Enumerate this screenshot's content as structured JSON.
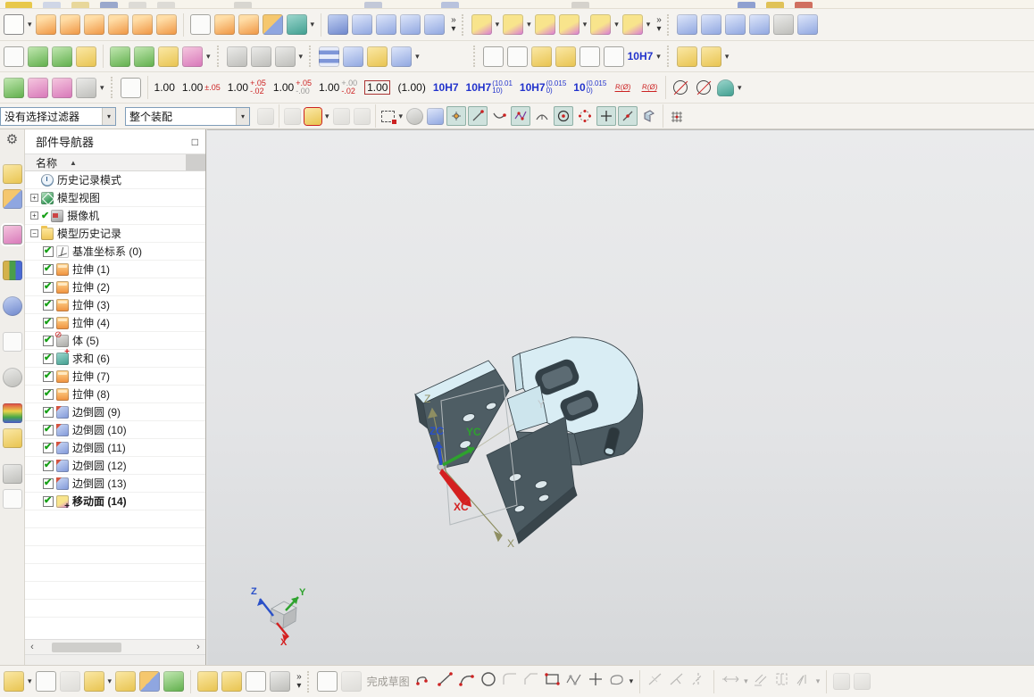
{
  "glyphs": {
    "caret": "▾",
    "more": "»",
    "sort": "▲",
    "box": "□",
    "left": "‹",
    "right": "›",
    "check": "✔",
    "gear": "⚙"
  },
  "toolbars": {
    "dim": {
      "items": [
        {
          "main": "1.00"
        },
        {
          "main": "1.00",
          "t": "±.05"
        },
        {
          "main": "1.00",
          "t": "+.05",
          "b": "-.02"
        },
        {
          "main": "1.00",
          "t": "+.05",
          "b": "-.00"
        },
        {
          "main": "1.00",
          "t": "+.00",
          "b": "-.02"
        },
        {
          "main": "1.00"
        },
        {
          "main": "(1.00)"
        },
        {
          "main": "10H7"
        },
        {
          "main": "10H7",
          "s1": "(10.01",
          "s2": "10)"
        },
        {
          "main": "10H7",
          "s1": "(0.015",
          "s2": "0)"
        },
        {
          "main": "10",
          "s1": "(0.015",
          "s2": "0)"
        }
      ],
      "radius_label": "R(Ø)"
    },
    "row3": {
      "fit_label": "10H7"
    }
  },
  "selection_bar": {
    "filter_value": "没有选择过滤器",
    "scope_value": "整个装配"
  },
  "navigator": {
    "title": "部件导航器",
    "column": "名称",
    "items": [
      {
        "label": "历史记录模式",
        "icon": "history-mode",
        "exp": ""
      },
      {
        "label": "模型视图",
        "icon": "model-views",
        "exp": "+"
      },
      {
        "label": "摄像机",
        "icon": "camera",
        "exp": "+",
        "pre": "✔"
      },
      {
        "label": "模型历史记录",
        "icon": "history-folder",
        "exp": "−"
      },
      {
        "label": "基准坐标系 (0)",
        "icon": "datum-csys",
        "checked": true
      },
      {
        "label": "拉伸 (1)",
        "icon": "extrude",
        "checked": true
      },
      {
        "label": "拉伸 (2)",
        "icon": "extrude",
        "checked": true
      },
      {
        "label": "拉伸 (3)",
        "icon": "extrude",
        "checked": true
      },
      {
        "label": "拉伸 (4)",
        "icon": "extrude",
        "checked": true
      },
      {
        "label": "体 (5)",
        "icon": "body",
        "checked": true
      },
      {
        "label": "求和 (6)",
        "icon": "unite",
        "checked": true
      },
      {
        "label": "拉伸 (7)",
        "icon": "extrude",
        "checked": true
      },
      {
        "label": "拉伸 (8)",
        "icon": "extrude",
        "checked": true
      },
      {
        "label": "边倒圆 (9)",
        "icon": "edge-blend",
        "checked": true
      },
      {
        "label": "边倒圆 (10)",
        "icon": "edge-blend",
        "checked": true
      },
      {
        "label": "边倒圆 (11)",
        "icon": "edge-blend",
        "checked": true
      },
      {
        "label": "边倒圆 (12)",
        "icon": "edge-blend",
        "checked": true
      },
      {
        "label": "边倒圆 (13)",
        "icon": "edge-blend",
        "checked": true
      },
      {
        "label": "移动面 (14)",
        "icon": "move-face",
        "checked": true,
        "bold": true
      }
    ]
  },
  "viewport": {
    "wcs": {
      "xc": "XC",
      "yc": "YC",
      "zc": "ZC"
    },
    "datum": {
      "x": "X",
      "y": "Y",
      "z": "Z"
    },
    "triad": {
      "x": "X",
      "y": "Y",
      "z": "Z"
    }
  },
  "bottom_bar": {
    "finish_sketch": "完成草图"
  },
  "colors": {
    "part_dark": "#4d5c63",
    "part_light": "#d9edf4",
    "xc": "#d42020",
    "yc": "#2ea22e",
    "zc": "#2a50c8",
    "datum_axis": "#8e8e62",
    "snap_on": "#cfe2dd"
  }
}
